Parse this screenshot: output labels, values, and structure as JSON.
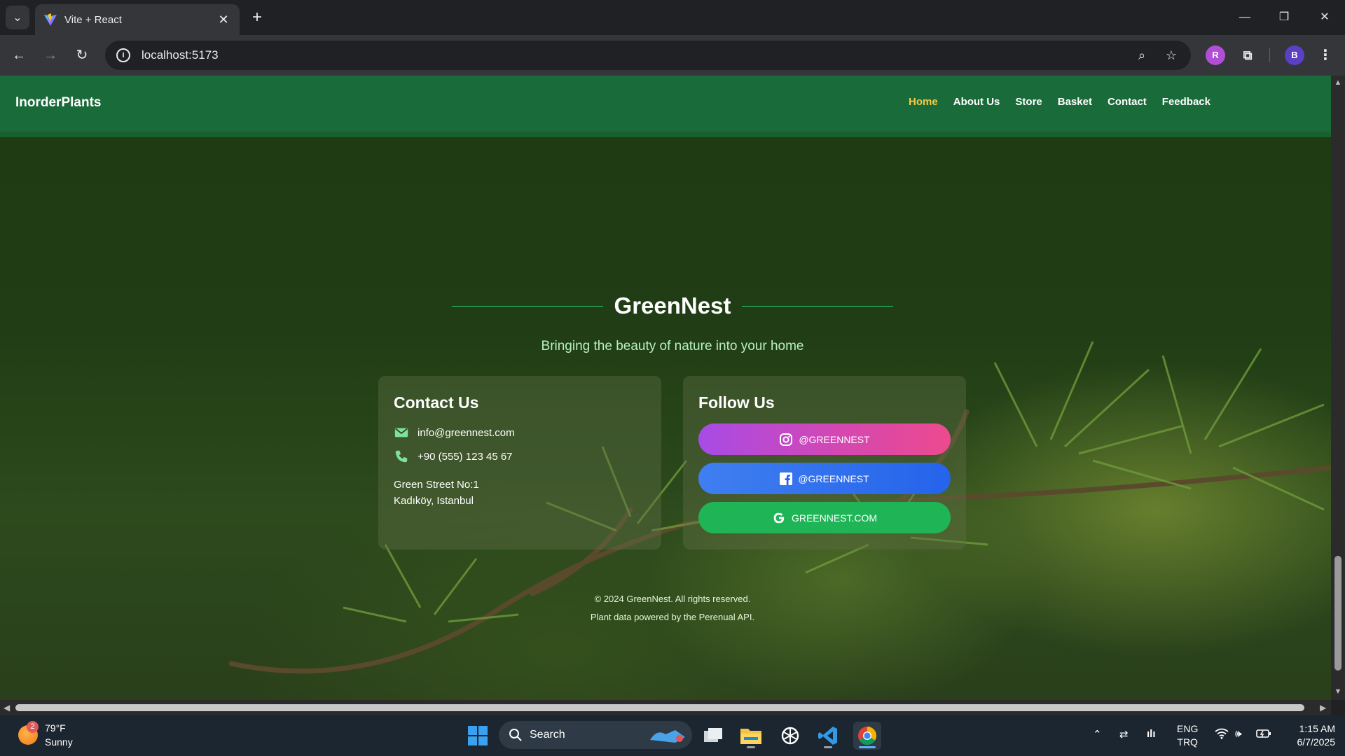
{
  "browser": {
    "tab_title": "Vite + React",
    "url": "localhost:5173",
    "profile_initial": "B",
    "extension_label": "R"
  },
  "site": {
    "brand": "InorderPlants",
    "nav": [
      {
        "label": "Home",
        "active": true
      },
      {
        "label": "About Us",
        "active": false
      },
      {
        "label": "Store",
        "active": false
      },
      {
        "label": "Basket",
        "active": false
      },
      {
        "label": "Contact",
        "active": false
      },
      {
        "label": "Feedback",
        "active": false
      }
    ],
    "hero": {
      "title": "GreenNest",
      "subtitle": "Bringing the beauty of nature into your home"
    },
    "contact": {
      "title": "Contact Us",
      "email": "info@greennest.com",
      "phone": "+90 (555) 123 45 67",
      "address_line1": "Green Street No:1",
      "address_line2": "Kadıköy, Istanbul"
    },
    "follow": {
      "title": "Follow Us",
      "instagram": "@GREENNEST",
      "facebook": "@GREENNEST",
      "website": "GREENNEST.COM"
    },
    "footer": {
      "copyright": "© 2024 GreenNest. All rights reserved.",
      "credit": "Plant data powered by the Perenual API."
    },
    "colors": {
      "navbar": "#1a6b3a",
      "active_link": "#f7c948",
      "accent_line": "#2fbf6a"
    }
  },
  "taskbar": {
    "weather_badge": "2",
    "weather_temp": "79°F",
    "weather_desc": "Sunny",
    "search_label": "Search",
    "lang_line1": "ENG",
    "lang_line2": "TRQ",
    "time": "1:15 AM",
    "date": "6/7/2025"
  }
}
